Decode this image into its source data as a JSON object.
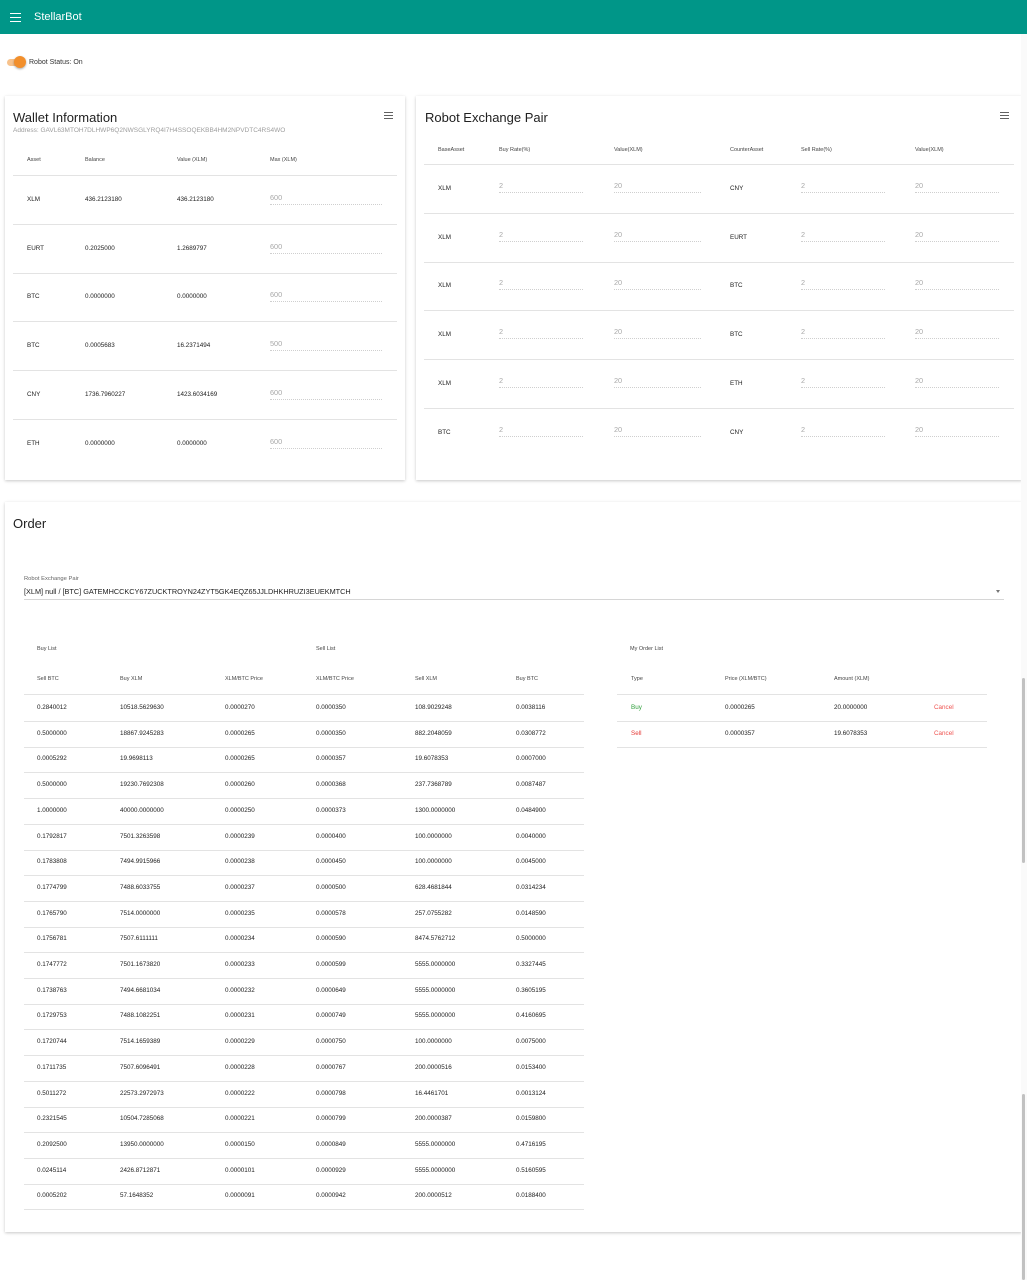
{
  "app": {
    "title": "StellarBot"
  },
  "robot_status": {
    "label": "Robot Status: On",
    "on": true
  },
  "wallet": {
    "title": "Wallet Information",
    "address": "Address: GAVL63MTOH7DLHWP6Q2NWSGLYRQ4I7H4SSOQEKBB4HM2NPVDTC4RS4WO",
    "headers": [
      "Asset",
      "Balance",
      "Value (XLM)",
      "Max (XLM)"
    ],
    "rows": [
      {
        "asset": "XLM",
        "balance": "436.2123180",
        "value": "436.2123180",
        "max": "600"
      },
      {
        "asset": "EURT",
        "balance": "0.2025000",
        "value": "1.2689797",
        "max": "600"
      },
      {
        "asset": "BTC",
        "balance": "0.0000000",
        "value": "0.0000000",
        "max": "600"
      },
      {
        "asset": "BTC",
        "balance": "0.0005683",
        "value": "16.2371494",
        "max": "500"
      },
      {
        "asset": "CNY",
        "balance": "1736.7960227",
        "value": "1423.6034169",
        "max": "600"
      },
      {
        "asset": "ETH",
        "balance": "0.0000000",
        "value": "0.0000000",
        "max": "600"
      }
    ]
  },
  "exchange_pair": {
    "title": "Robot Exchange Pair",
    "headers": [
      "BaseAsset",
      "Buy Rate(%)",
      "Value(XLM)",
      "CounterAsset",
      "Sell Rate(%)",
      "Value(XLM)"
    ],
    "rows": [
      {
        "base": "XLM",
        "buy_rate": "2",
        "buy_value": "20",
        "counter": "CNY",
        "sell_rate": "2",
        "sell_value": "20"
      },
      {
        "base": "XLM",
        "buy_rate": "2",
        "buy_value": "20",
        "counter": "EURT",
        "sell_rate": "2",
        "sell_value": "20"
      },
      {
        "base": "XLM",
        "buy_rate": "2",
        "buy_value": "20",
        "counter": "BTC",
        "sell_rate": "2",
        "sell_value": "20"
      },
      {
        "base": "XLM",
        "buy_rate": "2",
        "buy_value": "20",
        "counter": "BTC",
        "sell_rate": "2",
        "sell_value": "20"
      },
      {
        "base": "XLM",
        "buy_rate": "2",
        "buy_value": "20",
        "counter": "ETH",
        "sell_rate": "2",
        "sell_value": "20"
      },
      {
        "base": "BTC",
        "buy_rate": "2",
        "buy_value": "20",
        "counter": "CNY",
        "sell_rate": "2",
        "sell_value": "20"
      }
    ]
  },
  "order": {
    "title": "Order",
    "select_label": "Robot Exchange Pair",
    "select_value": "[XLM] null / [BTC] GATEMHCCKCY67ZUCKTROYN24ZYT5GK4EQZ65JJLDHKHRUZI3EUEKMTCH",
    "buy_list_title": "Buy List",
    "sell_list_title": "Sell List",
    "my_order_title": "My Order List",
    "buy_headers": [
      "Sell BTC",
      "Buy XLM",
      "XLM/BTC Price"
    ],
    "sell_headers": [
      "XLM/BTC Price",
      "Sell XLM",
      "Buy BTC"
    ],
    "my_headers": [
      "Type",
      "Price (XLM/BTC)",
      "Amount (XLM)"
    ],
    "book": [
      [
        "0.2840012",
        "10518.5629630",
        "0.0000270",
        "0.0000350",
        "108.9029248",
        "0.0038116"
      ],
      [
        "0.5000000",
        "18867.9245283",
        "0.0000265",
        "0.0000350",
        "882.2048059",
        "0.0308772"
      ],
      [
        "0.0005292",
        "19.9698113",
        "0.0000265",
        "0.0000357",
        "19.6078353",
        "0.0007000"
      ],
      [
        "0.5000000",
        "19230.7692308",
        "0.0000260",
        "0.0000368",
        "237.7368789",
        "0.0087487"
      ],
      [
        "1.0000000",
        "40000.0000000",
        "0.0000250",
        "0.0000373",
        "1300.0000000",
        "0.0484900"
      ],
      [
        "0.1792817",
        "7501.3263598",
        "0.0000239",
        "0.0000400",
        "100.0000000",
        "0.0040000"
      ],
      [
        "0.1783808",
        "7494.9915966",
        "0.0000238",
        "0.0000450",
        "100.0000000",
        "0.0045000"
      ],
      [
        "0.1774799",
        "7488.6033755",
        "0.0000237",
        "0.0000500",
        "628.4681844",
        "0.0314234"
      ],
      [
        "0.1765790",
        "7514.0000000",
        "0.0000235",
        "0.0000578",
        "257.0755282",
        "0.0148590"
      ],
      [
        "0.1756781",
        "7507.6111111",
        "0.0000234",
        "0.0000590",
        "8474.5762712",
        "0.5000000"
      ],
      [
        "0.1747772",
        "7501.1673820",
        "0.0000233",
        "0.0000599",
        "5555.0000000",
        "0.3327445"
      ],
      [
        "0.1738763",
        "7494.6681034",
        "0.0000232",
        "0.0000649",
        "5555.0000000",
        "0.3605195"
      ],
      [
        "0.1729753",
        "7488.1082251",
        "0.0000231",
        "0.0000749",
        "5555.0000000",
        "0.4160695"
      ],
      [
        "0.1720744",
        "7514.1659389",
        "0.0000229",
        "0.0000750",
        "100.0000000",
        "0.0075000"
      ],
      [
        "0.1711735",
        "7507.6096491",
        "0.0000228",
        "0.0000767",
        "200.0000516",
        "0.0153400"
      ],
      [
        "0.5011272",
        "22573.2972973",
        "0.0000222",
        "0.0000798",
        "16.4461701",
        "0.0013124"
      ],
      [
        "0.2321545",
        "10504.7285068",
        "0.0000221",
        "0.0000799",
        "200.0000387",
        "0.0159800"
      ],
      [
        "0.2092500",
        "13950.0000000",
        "0.0000150",
        "0.0000849",
        "5555.0000000",
        "0.4716195"
      ],
      [
        "0.0245114",
        "2426.8712871",
        "0.0000101",
        "0.0000929",
        "5555.0000000",
        "0.5160595"
      ],
      [
        "0.0005202",
        "57.1648352",
        "0.0000091",
        "0.0000942",
        "200.0000512",
        "0.0188400"
      ]
    ],
    "my_orders": [
      {
        "type": "Buy",
        "price": "0.0000265",
        "amount": "20.0000000",
        "action": "Cancel"
      },
      {
        "type": "Sell",
        "price": "0.0000357",
        "amount": "19.6078353",
        "action": "Cancel"
      }
    ]
  },
  "colors": {
    "appbar": "#009688",
    "toggle": "#f28f2c",
    "buy": "#2e9e3a",
    "sell": "#e53935"
  },
  "icons": {
    "menu": "hamburger-menu-icon",
    "card_menu": "hamburger-menu-icon",
    "select": "dropdown-arrow-icon"
  }
}
